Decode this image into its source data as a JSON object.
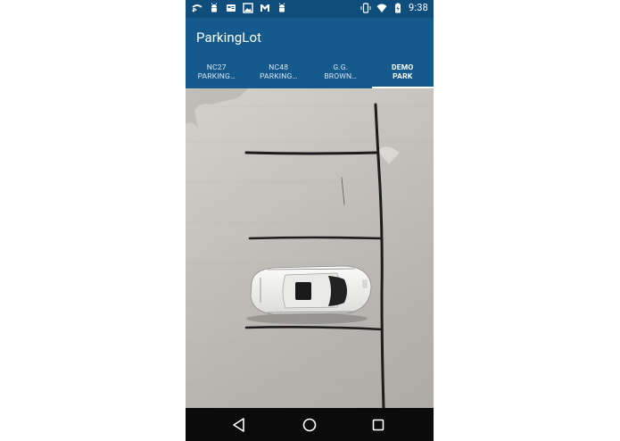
{
  "status_bar": {
    "time": "9:38",
    "left_icons": [
      "cast-icon",
      "android-icon",
      "sim-card-icon",
      "image-icon",
      "gmail-icon",
      "android-icon"
    ],
    "right_icons": [
      "vibrate-icon",
      "wifi-icon",
      "battery-charging-icon"
    ]
  },
  "app_bar": {
    "title": "ParkingLot"
  },
  "tabs": [
    {
      "line1": "NC27",
      "line2": "PARKING…",
      "active": false
    },
    {
      "line1": "NC48",
      "line2": "PARKING…",
      "active": false
    },
    {
      "line1": "G.G.",
      "line2": "BROWN…",
      "active": false
    },
    {
      "line1": "DEMO",
      "line2": "PARK",
      "active": true
    }
  ],
  "colors": {
    "status_bar": "#0f4d7c",
    "app_bar": "#145a8d",
    "nav_bar": "#0b0b0b",
    "cardboard": "#c9c6c1"
  },
  "nav_bar": {
    "buttons": [
      "back-icon",
      "home-icon",
      "recents-icon"
    ]
  }
}
